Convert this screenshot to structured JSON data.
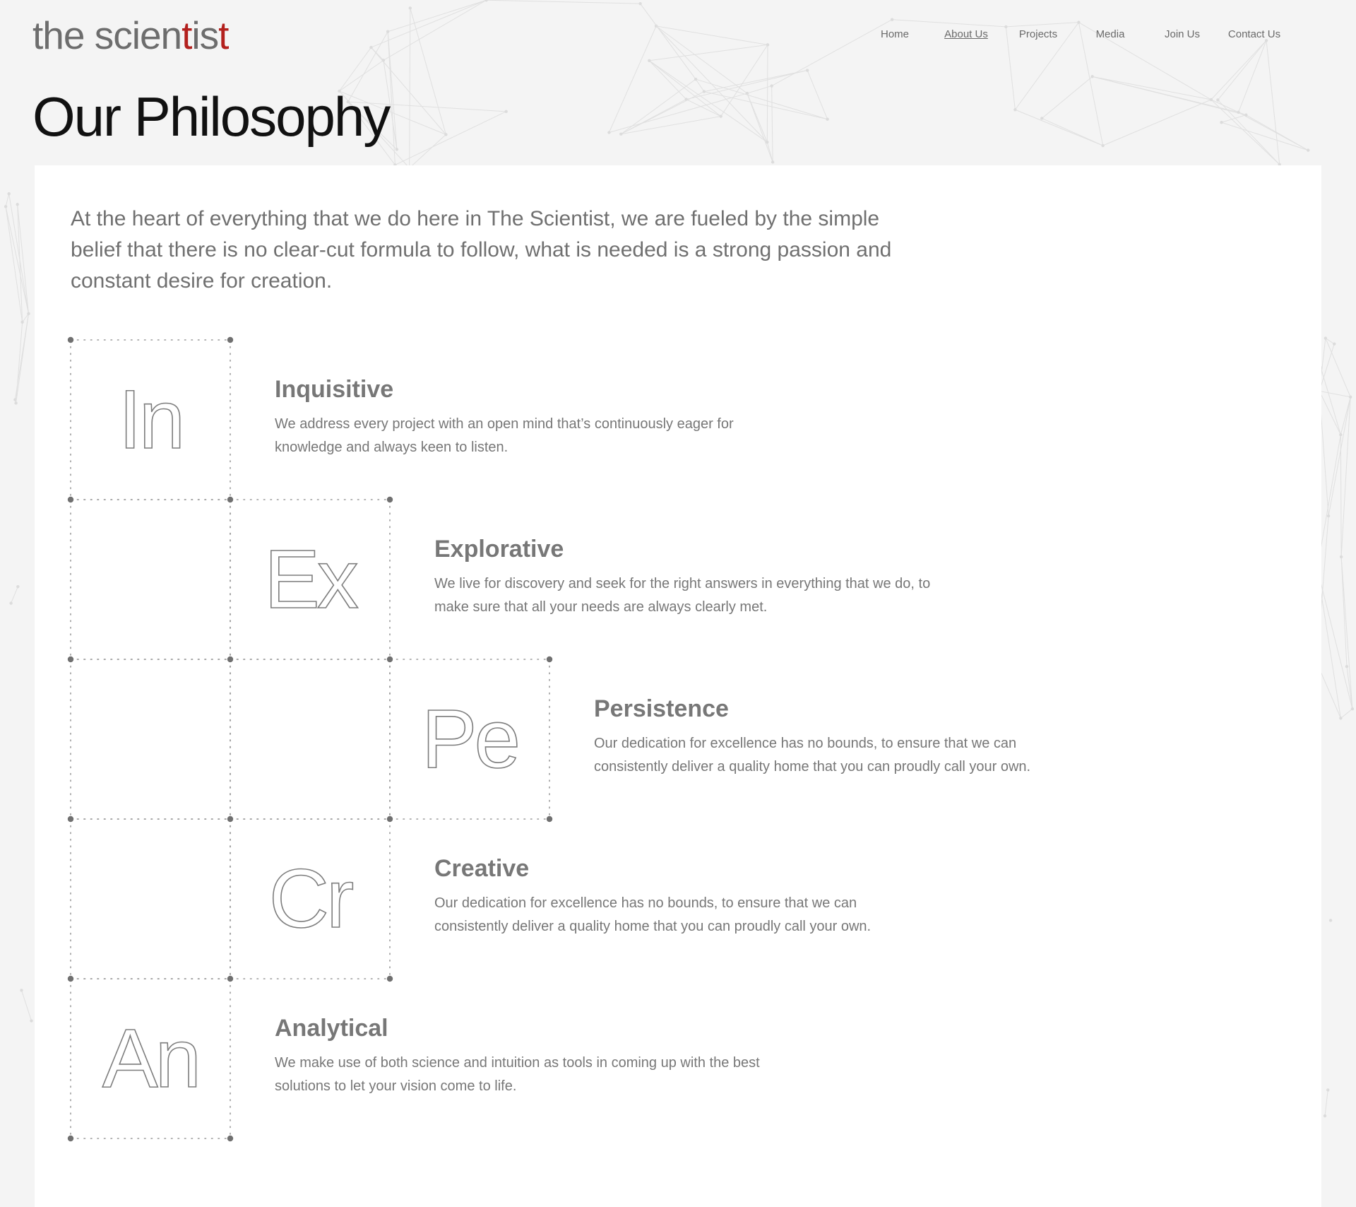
{
  "logo": {
    "part1": "the scien",
    "accent1": "t",
    "part2": "is",
    "accent2": "t"
  },
  "nav": [
    {
      "label": "Home",
      "active": false
    },
    {
      "label": "About Us",
      "active": true
    },
    {
      "label": "Projects",
      "active": false
    },
    {
      "label": "Media",
      "active": false
    },
    {
      "label": "Join Us",
      "active": false
    },
    {
      "label": "Contact Us",
      "active": false
    }
  ],
  "page_title": "Our Philosophy",
  "intro": "At the heart of everything that we do here in The Scientist, we are fueled by the simple belief that there is no clear-cut formula to follow, what is needed is a strong passion and constant desire for creation.",
  "pillars": [
    {
      "symbol": "In",
      "title": "Inquisitive",
      "description": "We address every project with an open mind that’s continuously eager for knowledge and always keen to listen."
    },
    {
      "symbol": "Ex",
      "title": "Explorative",
      "description": "We live for discovery and seek for the right answers in everything that we do, to make sure that all your needs are always clearly met."
    },
    {
      "symbol": "Pe",
      "title": "Persistence",
      "description": "Our dedication for excellence has no bounds, to ensure that we can consistently deliver a quality home that you can proudly call your own."
    },
    {
      "symbol": "Cr",
      "title": "Creative",
      "description": "Our dedication for excellence has no bounds, to ensure that we can consistently deliver a quality home that you can proudly call your own."
    },
    {
      "symbol": "An",
      "title": "Analytical",
      "description": "We make use of both science and intuition as tools in coming up with the best solutions to let your vision come to life."
    }
  ],
  "colors": {
    "brand_accent": "#b3201d",
    "background": "#f4f4f4",
    "panel": "#ffffff",
    "text_gray": "#777777"
  }
}
